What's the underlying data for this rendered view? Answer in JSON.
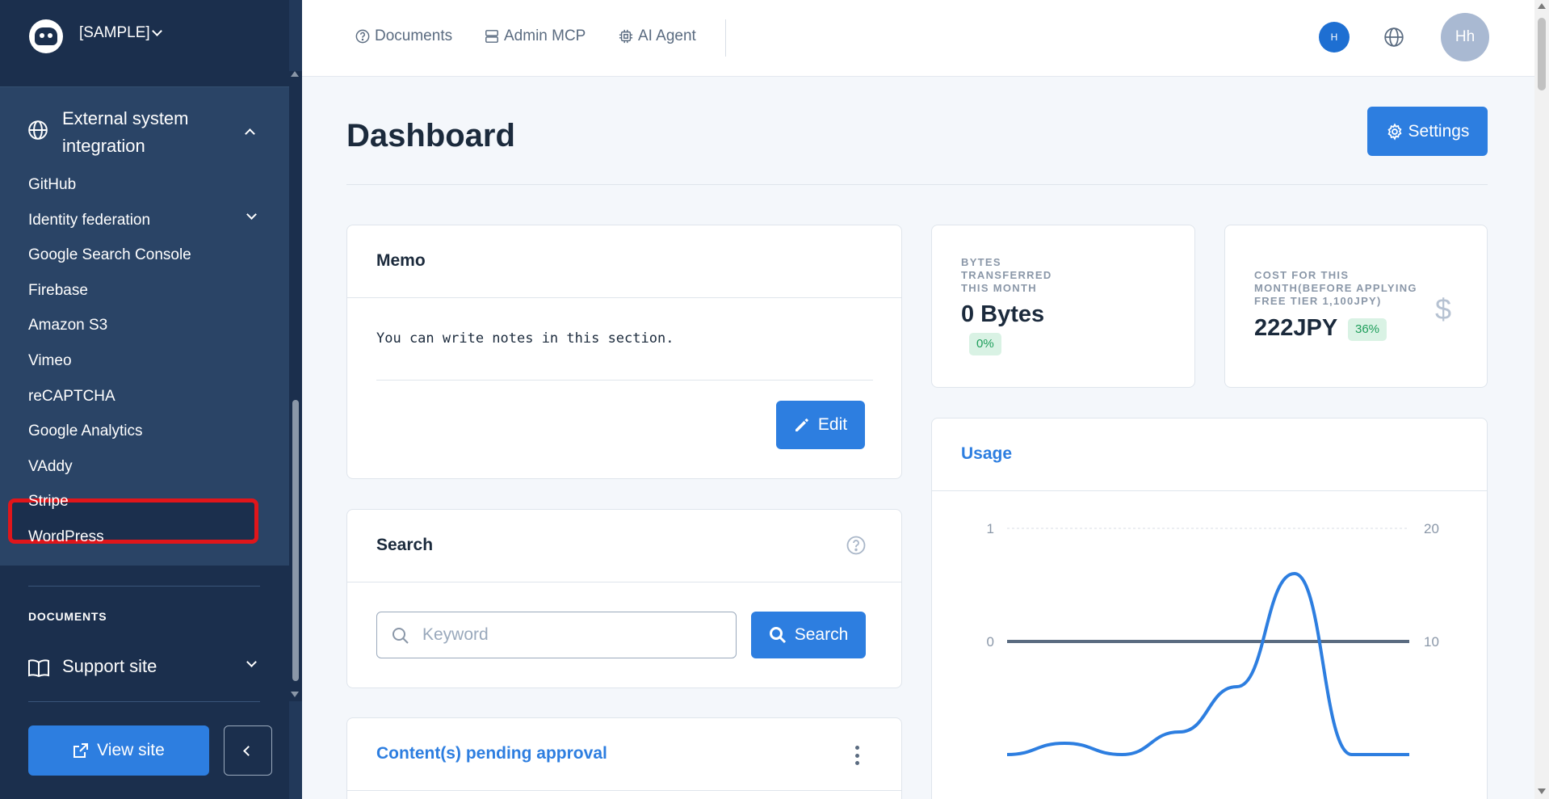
{
  "sidebar": {
    "site_name": "[SAMPLE]",
    "group": {
      "title": "External system integration",
      "icon": "globe-icon"
    },
    "items": [
      {
        "label": "GitHub",
        "has_children": false
      },
      {
        "label": "Identity federation",
        "has_children": true
      },
      {
        "label": "Google Search Console",
        "has_children": false
      },
      {
        "label": "Firebase",
        "has_children": false
      },
      {
        "label": "Amazon S3",
        "has_children": false
      },
      {
        "label": "Vimeo",
        "has_children": false
      },
      {
        "label": "reCAPTCHA",
        "has_children": false
      },
      {
        "label": "Google Analytics",
        "has_children": false,
        "highlighted": true
      },
      {
        "label": "VAddy",
        "has_children": false
      },
      {
        "label": "Stripe",
        "has_children": false
      },
      {
        "label": "WordPress",
        "has_children": false
      }
    ],
    "documents_section": {
      "label": "DOCUMENTS",
      "support_label": "Support site"
    },
    "view_site_label": "View site"
  },
  "topbar": {
    "links": [
      {
        "label": "Documents",
        "icon": "question-circle-icon"
      },
      {
        "label": "Admin MCP",
        "icon": "server-icon"
      },
      {
        "label": "AI Agent",
        "icon": "cpu-icon"
      }
    ],
    "small_avatar_initial": "H",
    "avatar_initials": "Hh"
  },
  "page": {
    "title": "Dashboard",
    "settings_label": "Settings"
  },
  "memo": {
    "title": "Memo",
    "text": "You can write notes in this section.",
    "edit_label": "Edit"
  },
  "search": {
    "title": "Search",
    "placeholder": "Keyword",
    "value": "",
    "button_label": "Search"
  },
  "pending": {
    "title": "Content(s) pending approval"
  },
  "stats": {
    "bytes": {
      "label_lines": [
        "BYTES",
        "TRANSFERRED",
        "THIS MONTH"
      ],
      "value": "0 Bytes",
      "badge": "0%"
    },
    "cost": {
      "label_lines": [
        "COST FOR THIS",
        "MONTH(BEFORE APPLYING",
        "FREE TIER 1,100JPY)"
      ],
      "value": "222JPY",
      "badge": "36%",
      "icon": "dollar-icon"
    }
  },
  "usage": {
    "title": "Usage"
  },
  "colors": {
    "sidebar_bg": "#22395a",
    "accent": "#2d7ee0",
    "highlight": "#e0161b",
    "badge_bg": "#d9f2e4",
    "badge_text": "#1e9e5b"
  },
  "chart_data": {
    "type": "line",
    "left_axis": {
      "ticks": [
        "1",
        "0"
      ],
      "ylim": [
        0,
        1
      ]
    },
    "right_axis": {
      "ticks": [
        "20",
        "10"
      ],
      "ylim": [
        0,
        20
      ]
    },
    "grid": true,
    "series": [
      {
        "axis": "left",
        "values": [
          0,
          0,
          0,
          0,
          0,
          0,
          0,
          0
        ],
        "color": "#5a6b80"
      },
      {
        "axis": "right",
        "values": [
          0,
          1,
          0,
          2,
          6,
          16,
          0,
          0
        ],
        "color": "#2d7ee0"
      }
    ]
  }
}
